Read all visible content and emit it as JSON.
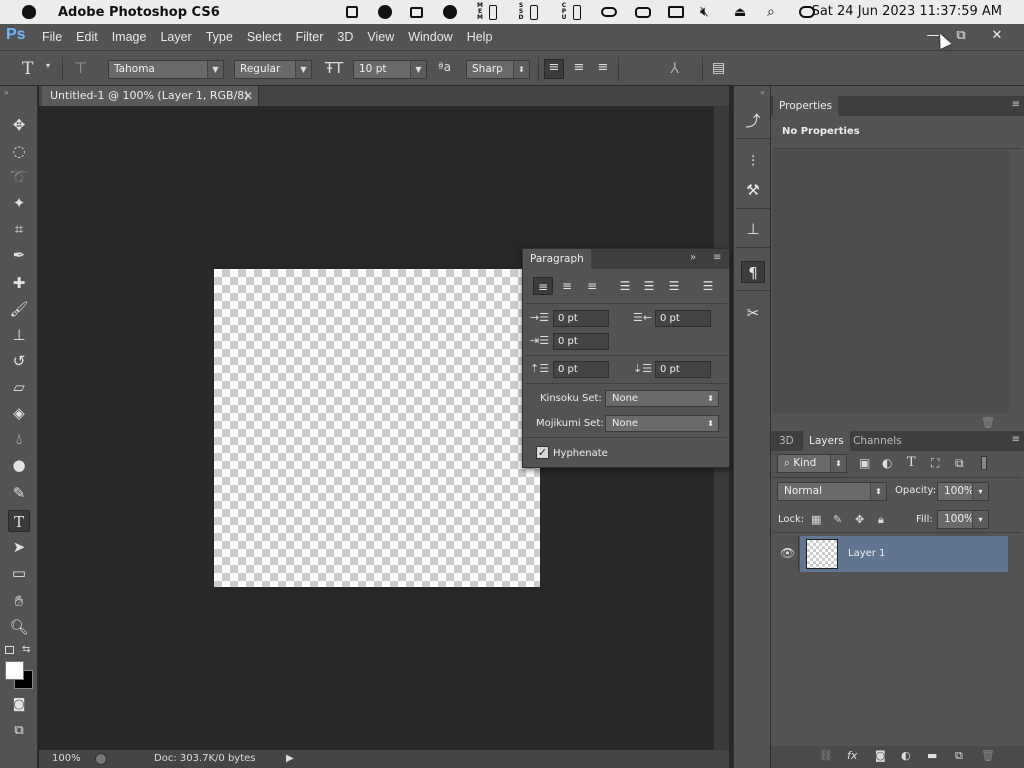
{
  "menubar": {
    "app_name": "Adobe Photoshop CS6",
    "clock": "Sat 24 Jun 2023  11:37:59 AM",
    "mini_labels": [
      "M\nE\nM",
      "S\nS\nD",
      "C\nP\nU"
    ]
  },
  "ps_menu": {
    "logo": "Ps",
    "items": [
      "File",
      "Edit",
      "Image",
      "Layer",
      "Type",
      "Select",
      "Filter",
      "3D",
      "View",
      "Window",
      "Help"
    ]
  },
  "options": {
    "font_family": "Tahoma",
    "font_style": "Regular",
    "font_size": "10 pt",
    "antialias": "Sharp",
    "aa_label": "ªa"
  },
  "document": {
    "tab_title": "Untitled-1 @ 100% (Layer 1, RGB/8)",
    "zoom": "100%",
    "doc_info": "Doc: 303.7K/0 bytes"
  },
  "properties": {
    "tab": "Properties",
    "empty_text": "No Properties"
  },
  "paragraph": {
    "title": "Paragraph",
    "indent_left": "0 pt",
    "indent_right": "0 pt",
    "indent_first": "0 pt",
    "space_before": "0 pt",
    "space_after": "0 pt",
    "kinsoku_label": "Kinsoku Set:",
    "kinsoku_value": "None",
    "mojikumi_label": "Mojikumi Set:",
    "mojikumi_value": "None",
    "hyphenate_label": "Hyphenate",
    "hyphenate_checked": true
  },
  "layers": {
    "tabs": [
      "3D",
      "Layers",
      "Channels"
    ],
    "active_tab": "Layers",
    "filter_kind": "Kind",
    "blend_mode": "Normal",
    "opacity_label": "Opacity:",
    "opacity": "100%",
    "lock_label": "Lock:",
    "fill_label": "Fill:",
    "fill": "100%",
    "items": [
      {
        "name": "Layer 1",
        "visible": true,
        "selected": true
      }
    ]
  },
  "colors": {
    "accent_selected_layer": "#5f7592",
    "ps_logo": "#6fb7ff"
  }
}
